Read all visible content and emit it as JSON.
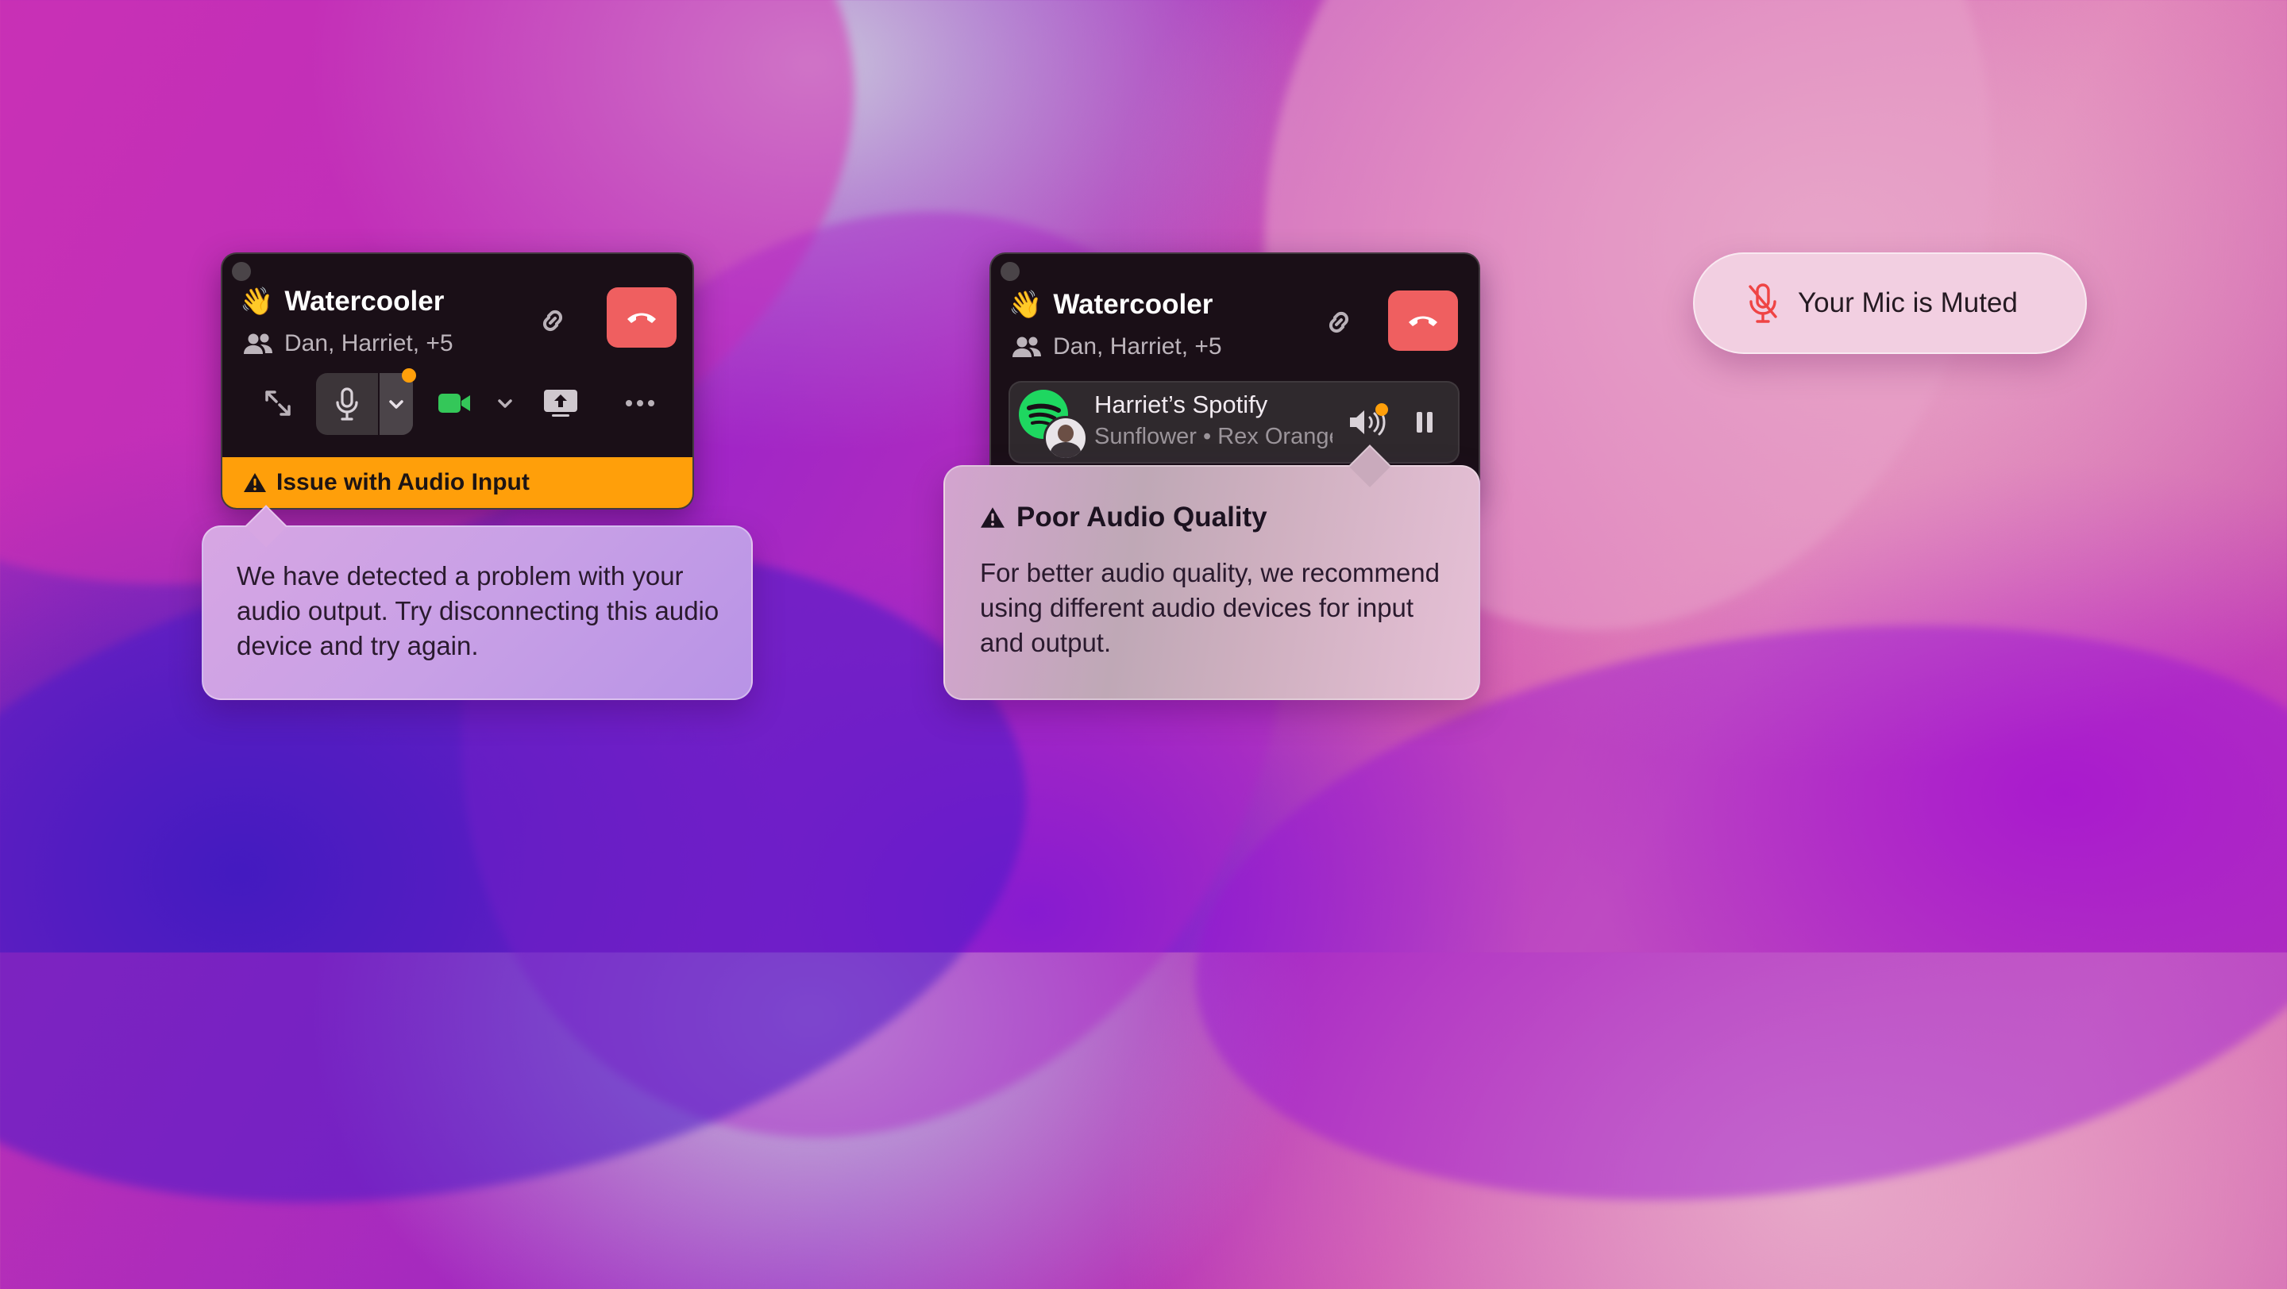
{
  "widget_left": {
    "wave_emoji": "👋",
    "title": "Watercooler",
    "participants": "Dan, Harriet, +5",
    "banner_text": "Issue with Audio Input",
    "has_mic_alert": true
  },
  "tooltip_left": {
    "text": "We have detected a problem with your audio output. Try disconnecting this audio device and try again."
  },
  "widget_right": {
    "wave_emoji": "👋",
    "title": "Watercooler",
    "participants": "Dan, Harriet, +5",
    "media": {
      "title": "Harriet’s Spotify",
      "subtitle": "Sunflower • Rex Orange County",
      "has_output_alert": true
    }
  },
  "tooltip_right": {
    "title": "Poor Audio Quality",
    "text": "For better audio quality, we recommend using different audio devices for input and output."
  },
  "mute_pill": {
    "label": "Your Mic is Muted"
  },
  "colors": {
    "end_call": "#ef5f60",
    "warning": "#ff9f0a",
    "camera": "#34c759",
    "spotify": "#1ed760",
    "mic_muted": "#ef4444"
  },
  "icons": [
    "wave-emoji",
    "people-icon",
    "link-icon",
    "end-call-icon",
    "expand-icon",
    "mic-icon",
    "chevron-down-icon",
    "camera-icon",
    "screen-share-icon",
    "more-icon",
    "warning-icon",
    "spotify-icon",
    "speaker-icon",
    "pause-icon",
    "mic-muted-icon"
  ]
}
